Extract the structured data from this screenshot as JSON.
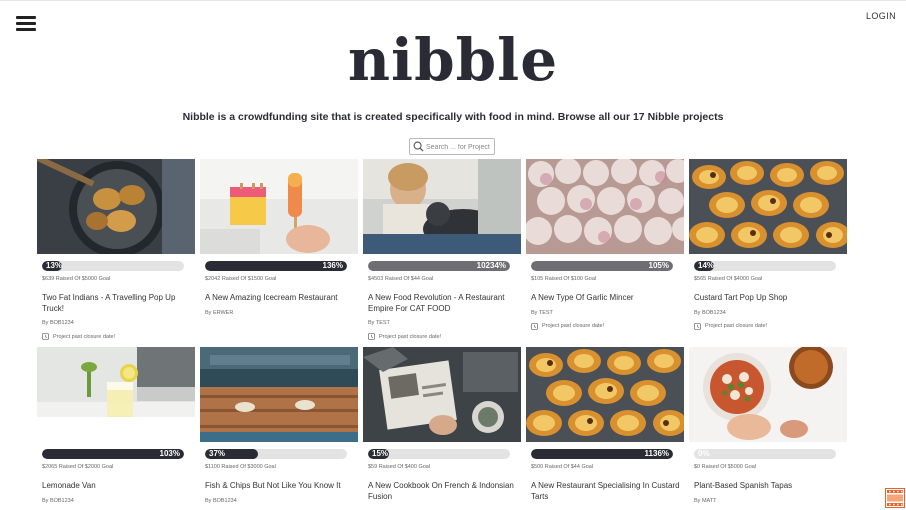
{
  "header": {
    "login_label": "LOGIN",
    "logo_text": "nibble",
    "tagline": "Nibble is a crowdfunding site that is created specifically with food in mind. Browse all our 17 Nibble projects",
    "search_placeholder": "Search ... for Project"
  },
  "colors": {
    "brand_dark": "#2b2b36",
    "bar_track": "#e3e3e3",
    "bar_past_closure": "#6f6f73",
    "film_icon": "#e8622a"
  },
  "projects": [
    {
      "progress_label": "13%",
      "progress": 0.13,
      "raised": "$639 Raised Of $5000 Goal",
      "title": "Two Fat Indians - A Travelling Pop Up Truck!",
      "by": "By BOB1234",
      "closure": "Project past closure date!",
      "image": "fried-snacks"
    },
    {
      "progress_label": "136%",
      "progress": 1.0,
      "raised": "$2042 Raised Of $1500 Goal",
      "title": "A New Amazing Icecream Restaurant",
      "by": "By ERWER",
      "closure": "",
      "image": "ice-lollies"
    },
    {
      "progress_label": "10234%",
      "progress": 1.0,
      "raised": "$4503 Raised Of $44 Goal",
      "title": "A New Food Revolution - A Restaurant Empire For CAT FOOD",
      "by": "By TEST",
      "closure": "Project past closure date!",
      "image": "child-with-cat"
    },
    {
      "progress_label": "105%",
      "progress": 1.0,
      "raised": "$105 Raised Of $100 Goal",
      "title": "A New Type Of Garlic Mincer",
      "by": "By TEST",
      "closure": "Project past closure date!",
      "image": "garlic"
    },
    {
      "progress_label": "14%",
      "progress": 0.14,
      "raised": "$565 Raised Of $4000 Goal",
      "title": "Custard Tart Pop Up Shop",
      "by": "By BOB1234",
      "closure": "Project past closure date!",
      "image": "custard-tarts"
    },
    {
      "progress_label": "103%",
      "progress": 1.0,
      "raised": "$2065 Raised Of $2000 Goal",
      "title": "Lemonade Van",
      "by": "By BOB1234",
      "closure": "",
      "image": "lemonade"
    },
    {
      "progress_label": "37%",
      "progress": 0.37,
      "raised": "$1100 Raised Of $3000 Goal",
      "title": "Fish & Chips But Not Like You Know It",
      "by": "By BOB1234",
      "closure": "",
      "image": "fish-and-chips-table"
    },
    {
      "progress_label": "15%",
      "progress": 0.15,
      "raised": "$59 Raised Of $400 Goal",
      "title": "A New Cookbook On French & Indonsian Fusion",
      "by": "",
      "closure": "",
      "image": "cookbook"
    },
    {
      "progress_label": "1136%",
      "progress": 1.0,
      "raised": "$500 Raised Of $44 Goal",
      "title": "A New Restaurant Specialising In Custard Tarts",
      "by": "",
      "closure": "",
      "image": "custard-tarts"
    },
    {
      "progress_label": "0%",
      "progress": 0.0,
      "raised": "$0 Raised Of $5000 Goal",
      "title": "Plant-Based Spanish Tapas",
      "by": "By MATT",
      "closure": "",
      "image": "tapas"
    }
  ]
}
